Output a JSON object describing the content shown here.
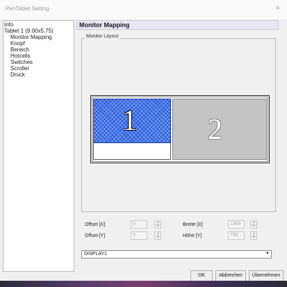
{
  "window": {
    "title": "PenTablet Setting",
    "close_icon": "×"
  },
  "tree": {
    "items": [
      {
        "label": "Info"
      },
      {
        "label": "Tablet  1 (9.00x5.75)"
      },
      {
        "label": "Monitor Mapping"
      },
      {
        "label": "Knopf"
      },
      {
        "label": "Bereich"
      },
      {
        "label": "Hotcells"
      },
      {
        "label": "Switches"
      },
      {
        "label": "Scroller"
      },
      {
        "label": "Druck"
      }
    ]
  },
  "panel": {
    "title": "Monitor Mapping",
    "group_label": "Monitor Layout",
    "monitors": [
      {
        "number": "1",
        "selected": true,
        "color": "#2a5fe0"
      },
      {
        "number": "2",
        "selected": false,
        "color": "#c4c4c4"
      }
    ],
    "fields": {
      "offset_x": {
        "label": "Offset [X]",
        "value": "0"
      },
      "offset_y": {
        "label": "Offset [Y]",
        "value": "0"
      },
      "width": {
        "label": "Breite [X]",
        "value": "1366"
      },
      "height": {
        "label": "Höhe [Y]",
        "value": "768"
      }
    },
    "display_select": {
      "value": "DISPLAY1"
    }
  },
  "buttons": {
    "ok": "OK",
    "cancel": "Abbrechen",
    "apply": "Übernehmen"
  }
}
